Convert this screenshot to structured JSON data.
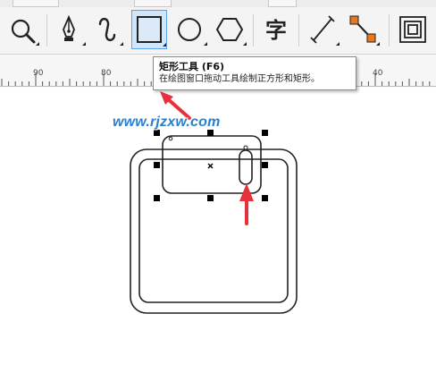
{
  "toolbar": {
    "tools": [
      {
        "name": "zoom-tool",
        "icon": "magnifier-icon"
      },
      {
        "name": "pen-tool",
        "icon": "pen-nib-icon"
      },
      {
        "name": "artistic-media-tool",
        "icon": "curve-icon"
      },
      {
        "name": "rectangle-tool",
        "icon": "rectangle-icon",
        "active": true
      },
      {
        "name": "ellipse-tool",
        "icon": "ellipse-icon"
      },
      {
        "name": "polygon-tool",
        "icon": "hexagon-icon"
      },
      {
        "name": "text-tool",
        "icon": "text-icon",
        "glyph": "字"
      },
      {
        "name": "parallel-dimension-tool",
        "icon": "dimension-line-icon"
      },
      {
        "name": "connector-tool",
        "icon": "connector-icon"
      },
      {
        "name": "contour-tool",
        "icon": "contour-icon"
      }
    ],
    "accent_color": "#5ca4e6",
    "active_bg": "#cfe6fb"
  },
  "ruler": {
    "labels": [
      "90",
      "80",
      "70",
      "60",
      "50",
      "40"
    ]
  },
  "tooltip": {
    "title": "矩形工具 (F6)",
    "description": "在绘图窗口拖动工具绘制正方形和矩形。"
  },
  "watermark": {
    "text": "www.rjzxw.com",
    "color": "#2a7fd0"
  },
  "annotation": {
    "arrow_color": "#e8303a"
  }
}
